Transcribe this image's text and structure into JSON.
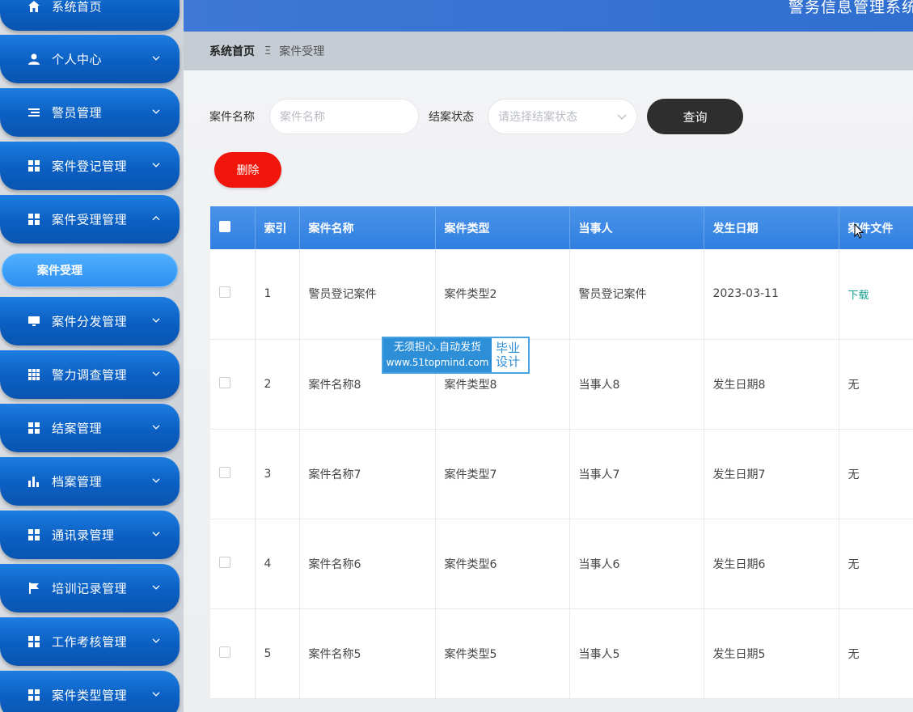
{
  "header": {
    "system_title": "警务信息管理系统"
  },
  "sidebar": {
    "items": [
      {
        "label": "系统首页",
        "icon": "home-icon"
      },
      {
        "label": "个人中心",
        "icon": "user-icon"
      },
      {
        "label": "警员管理",
        "icon": "list-icon"
      },
      {
        "label": "案件登记管理",
        "icon": "grid-icon"
      },
      {
        "label": "案件受理管理",
        "icon": "grid-icon"
      },
      {
        "label": "案件分发管理",
        "icon": "monitor-icon"
      },
      {
        "label": "警力调查管理",
        "icon": "apps-icon"
      },
      {
        "label": "结案管理",
        "icon": "grid-icon"
      },
      {
        "label": "档案管理",
        "icon": "bar-chart-icon"
      },
      {
        "label": "通讯录管理",
        "icon": "grid-icon"
      },
      {
        "label": "培训记录管理",
        "icon": "flag-icon"
      },
      {
        "label": "工作考核管理",
        "icon": "grid-icon"
      },
      {
        "label": "案件类型管理",
        "icon": "grid-icon"
      }
    ],
    "active_sub_item": "案件受理"
  },
  "breadcrumb": {
    "home": "系统首页",
    "separator": "Ξ",
    "current": "案件受理"
  },
  "search": {
    "case_name_label": "案件名称",
    "case_name_placeholder": "案件名称",
    "status_label": "结案状态",
    "status_placeholder": "请选择结案状态",
    "query_button": "查询"
  },
  "actions": {
    "delete_button": "删除"
  },
  "table": {
    "columns": [
      "索引",
      "案件名称",
      "案件类型",
      "当事人",
      "发生日期",
      "案件文件"
    ],
    "rows": [
      {
        "index": "1",
        "name": "警员登记案件",
        "type": "案件类型2",
        "party": "警员登记案件",
        "date": "2023-03-11",
        "file": "下载"
      },
      {
        "index": "2",
        "name": "案件名称8",
        "type": "案件类型8",
        "party": "当事人8",
        "date": "发生日期8",
        "file": "无"
      },
      {
        "index": "3",
        "name": "案件名称7",
        "type": "案件类型7",
        "party": "当事人7",
        "date": "发生日期7",
        "file": "无"
      },
      {
        "index": "4",
        "name": "案件名称6",
        "type": "案件类型6",
        "party": "当事人6",
        "date": "发生日期6",
        "file": "无"
      },
      {
        "index": "5",
        "name": "案件名称5",
        "type": "案件类型5",
        "party": "当事人5",
        "date": "发生日期5",
        "file": "无"
      }
    ]
  },
  "watermark": {
    "line1": "无须担心.自动发货",
    "url": "www.51topmind.com",
    "side1": "毕业",
    "side2": "设计"
  },
  "colors": {
    "sidebar_blue": "#0b5fc2",
    "header_blue": "#3f78d6",
    "delete_red": "#f0160b",
    "query_dark": "#2e2e2e",
    "link_teal": "#17a08f"
  }
}
